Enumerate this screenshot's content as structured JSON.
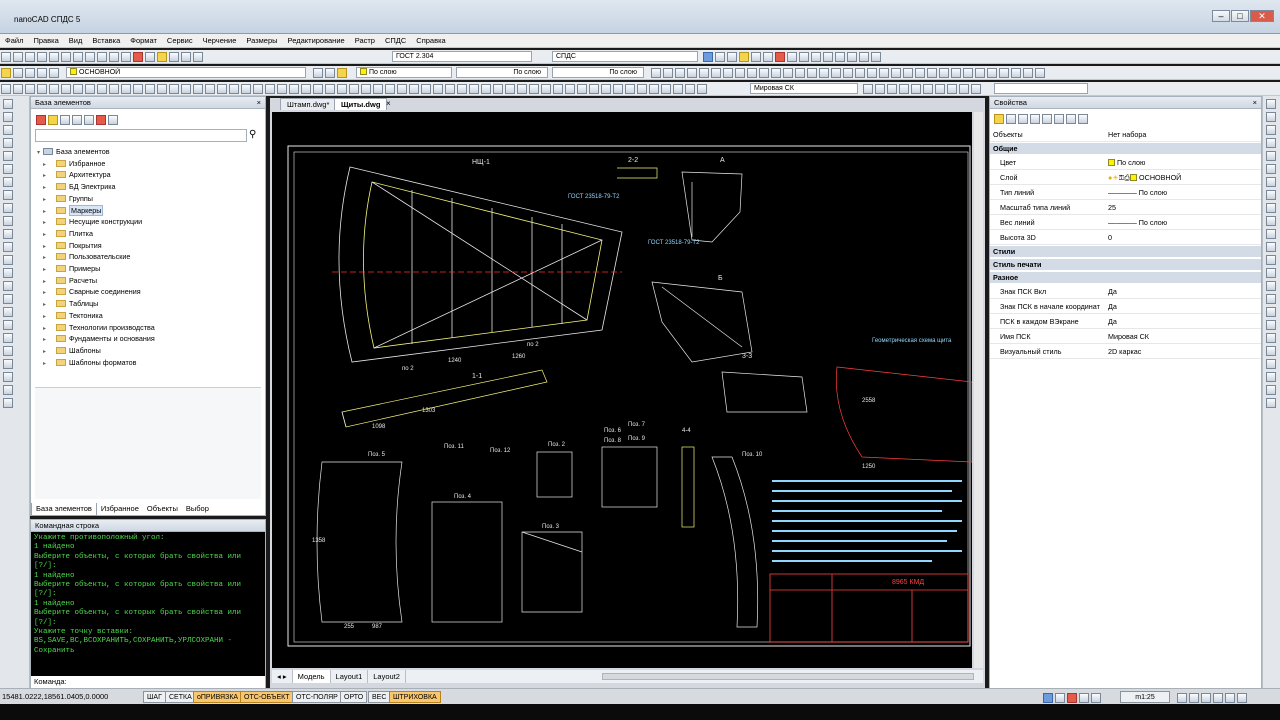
{
  "app": {
    "title": "nanoCAD СПДС 5"
  },
  "menu": [
    "Файл",
    "Правка",
    "Вид",
    "Вставка",
    "Формат",
    "Сервис",
    "Черчение",
    "Размеры",
    "Редактирование",
    "Растр",
    "СПДС",
    "Справка"
  ],
  "toolbar": {
    "style_combo": "ГОСТ 2.304",
    "spds_combo": "СПДС",
    "layer_combo": "ОСНОВНОЙ",
    "color_combo": "По слою",
    "linetype_combo": "По слою",
    "lineweight_combo": "По слою",
    "ucs_combo": "Мировая СК"
  },
  "element_base": {
    "title": "База элементов",
    "root": "База элементов",
    "items": [
      "Избранное",
      "Архитектура",
      "БД Электрика",
      "Группы",
      "Маркеры",
      "Несущие конструкции",
      "Плитка",
      "Покрытия",
      "Пользовательские",
      "Примеры",
      "Расчеты",
      "Сварные соединения",
      "Таблицы",
      "Тектоника",
      "Технологии производства",
      "Фундаменты и основания",
      "Шаблоны",
      "Шаблоны форматов"
    ],
    "tabs": [
      "База элементов",
      "Избранное",
      "Объекты",
      "Выбор"
    ]
  },
  "command": {
    "title": "Командная строка",
    "lines": [
      "Укажите противоположный угол:",
      "",
      "1 найдено",
      "Выберите объекты, с которых брать свойства или",
      "[?/]:",
      "1 найдено",
      "Выберите объекты, с которых брать свойства или",
      "[?/]:",
      "1 найдено",
      "Выберите объекты, с которых брать свойства или",
      "[?/]:",
      "Укажите точку вставки:",
      "",
      "ВS,SAVE,ВС,ВСОХРАНИТЬ,СОХРАНИТЬ,УРЛСОХРАНИ -",
      "Сохранить"
    ],
    "prompt": "Команда:"
  },
  "documents": {
    "tabs": [
      "Штамп.dwg*",
      "Щиты.dwg"
    ],
    "active": 1
  },
  "layouts": [
    "Модель",
    "Layout1",
    "Layout2"
  ],
  "drawing": {
    "labels": [
      "НЩ-1",
      "2-2",
      "A",
      "ГОСТ 23518-79-Т2",
      "ГОСТ 23518-79-Т2",
      "Б",
      "1-1",
      "3-3",
      "Поз. 5",
      "Поз. 11",
      "Поз. 12",
      "Поз. 4",
      "Поз. 2",
      "Поз. 3",
      "Поз. 6",
      "Поз. 7",
      "Поз. 8",
      "Поз. 9",
      "Поз. 10",
      "4-4",
      "Геометрическая схема щита",
      "8965 КМД"
    ],
    "dims": [
      "1240",
      "1260",
      "1250",
      "1303",
      "2558",
      "1358",
      "1098",
      "255",
      "987",
      "по 2",
      "по 2"
    ]
  },
  "properties": {
    "title": "Свойства",
    "objects_label": "Объекты",
    "objects_value": "Нет набора",
    "sections": {
      "general": "Общие",
      "styles": "Стили",
      "print_style": "Стиль печати",
      "misc": "Разное"
    },
    "general": [
      {
        "k": "Цвет",
        "v": "По слою"
      },
      {
        "k": "Слой",
        "v": "ОСНОВНОЙ"
      },
      {
        "k": "Тип линий",
        "v": "По слою"
      },
      {
        "k": "Масштаб типа линий",
        "v": "25"
      },
      {
        "k": "Вес линий",
        "v": "По слою"
      },
      {
        "k": "Высота 3D",
        "v": "0"
      }
    ],
    "misc": [
      {
        "k": "Знак ПСК Вкл",
        "v": "Да"
      },
      {
        "k": "Знак ПСК в начале координат",
        "v": "Да"
      },
      {
        "k": "ПСК в каждом ВЭкране",
        "v": "Да"
      },
      {
        "k": "Имя ПСК",
        "v": "Мировая СК"
      },
      {
        "k": "Визуальный стиль",
        "v": "2D каркас"
      }
    ]
  },
  "status": {
    "coords": "15481.0222,18561.0405,0.0000",
    "buttons": [
      "ШАГ",
      "СЕТКА",
      "оПРИВЯЗКА",
      "ОТС-ОБЪЕКТ",
      "ОТС-ПОЛЯР",
      "ОРТО",
      "ВЕС",
      "ШТРИХОВКА"
    ],
    "on": [
      2,
      3,
      7
    ],
    "scale": "m1:25"
  }
}
